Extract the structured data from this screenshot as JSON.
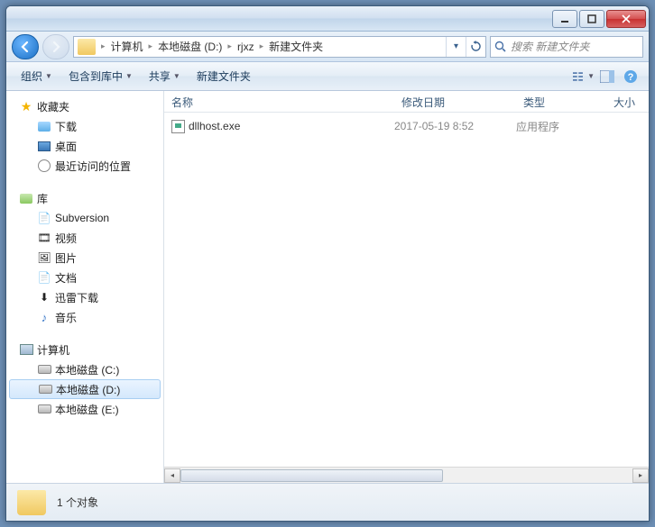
{
  "window": {
    "minimize": "−",
    "maximize": "▢",
    "close": "✕"
  },
  "breadcrumb": {
    "segments": [
      "计算机",
      "本地磁盘 (D:)",
      "rjxz",
      "新建文件夹"
    ]
  },
  "search": {
    "placeholder": "搜索 新建文件夹"
  },
  "toolbar": {
    "organize": "组织",
    "include": "包含到库中",
    "share": "共享",
    "newfolder": "新建文件夹"
  },
  "sidebar": {
    "favorites": {
      "label": "收藏夹",
      "items": [
        "下载",
        "桌面",
        "最近访问的位置"
      ]
    },
    "libraries": {
      "label": "库",
      "items": [
        "Subversion",
        "视频",
        "图片",
        "文档",
        "迅雷下载",
        "音乐"
      ]
    },
    "computer": {
      "label": "计算机",
      "items": [
        "本地磁盘 (C:)",
        "本地磁盘 (D:)",
        "本地磁盘 (E:)"
      ]
    }
  },
  "columns": {
    "name": "名称",
    "date": "修改日期",
    "type": "类型",
    "size": "大小"
  },
  "files": [
    {
      "name": "dllhost.exe",
      "date": "2017-05-19 8:52",
      "type": "应用程序"
    }
  ],
  "status": {
    "count": "1 个对象"
  }
}
